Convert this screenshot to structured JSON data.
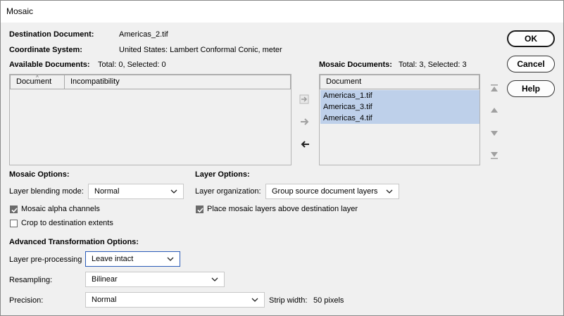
{
  "window": {
    "title": "Mosaic"
  },
  "buttons": {
    "ok": "OK",
    "cancel": "Cancel",
    "help": "Help"
  },
  "info": {
    "dest_label": "Destination Document:",
    "dest_value": "Americas_2.tif",
    "coord_label": "Coordinate System:",
    "coord_value": "United States: Lambert Conformal Conic, meter"
  },
  "available": {
    "label": "Available Documents:",
    "summary": "Total: 0, Selected: 0",
    "columns": [
      "Document",
      "Incompatibility"
    ]
  },
  "mosaic_docs": {
    "label": "Mosaic Documents:",
    "summary": "Total: 3, Selected: 3",
    "column": "Document",
    "items": [
      "Americas_1.tif",
      "Americas_3.tif",
      "Americas_4.tif"
    ]
  },
  "mosaic_options": {
    "heading": "Mosaic Options:",
    "blend_label": "Layer blending mode:",
    "blend_value": "Normal",
    "alpha_label": "Mosaic alpha channels",
    "alpha_checked": true,
    "crop_label": "Crop to destination extents",
    "crop_checked": false
  },
  "layer_options": {
    "heading": "Layer Options:",
    "org_label": "Layer organization:",
    "org_value": "Group source document layers",
    "place_label": "Place mosaic layers above destination layer",
    "place_checked": true
  },
  "advanced": {
    "heading": "Advanced Transformation Options:",
    "preproc_label": "Layer pre-processing",
    "preproc_value": "Leave intact",
    "resampling_label": "Resampling:",
    "resampling_value": "Bilinear",
    "precision_label": "Precision:",
    "precision_value": "Normal",
    "strip_label": "Strip width:",
    "strip_value": "50 pixels"
  },
  "icons": {
    "move_all_right": "double-arrow-right-icon",
    "move_right": "arrow-right-icon",
    "move_left": "arrow-left-icon",
    "move_top": "move-to-top-icon",
    "move_up": "move-up-icon",
    "move_down": "move-down-icon",
    "move_bottom": "move-to-bottom-icon"
  },
  "colors": {
    "selection": "#bed0ea",
    "focus_border": "#2b5bb8"
  }
}
